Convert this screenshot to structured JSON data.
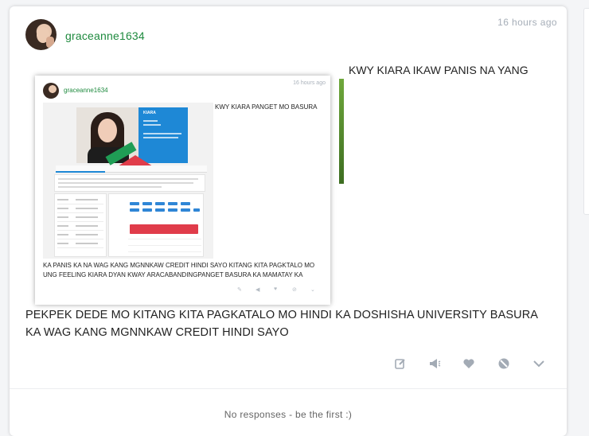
{
  "post": {
    "username": "graceanne1634",
    "time": "16 hours ago",
    "top_text": "KWY KIARA IKAW PANIS NA YANG",
    "main_text": "PEKPEK DEDE MO KITANG KITA PAGKATALO MO HINDI KA DOSHISHA UNIVERSITY BASURA KA WAG KANG MGNNKAW CREDIT HINDI SAYO"
  },
  "embedded": {
    "username": "graceanne1634",
    "time": "16 hours ago",
    "text1": "KWY KIARA PANGET MO BASURA",
    "text2": "KA PANIS KA NA WAG KANG MGNNKAW CREDIT HINDI SAYO KITANG KITA PAGKTALO MO UNG FEELING KIARA DYAN KWAY ARACABANDINGPANGET BASURA KA MAMATAY KA",
    "inner_title": "KIARA"
  },
  "actions": [
    {
      "name": "edit-icon",
      "glyph": "✎"
    },
    {
      "name": "announce-icon",
      "glyph": "📢"
    },
    {
      "name": "heart-icon",
      "glyph": "♥"
    },
    {
      "name": "block-icon",
      "glyph": "⊘"
    },
    {
      "name": "chevron-down-icon",
      "glyph": "⌄"
    }
  ],
  "responses": "No responses - be the first :)",
  "colors": {
    "username": "#1e8a3e",
    "meta": "#a6aeb8",
    "icon": "#a3abb5"
  }
}
